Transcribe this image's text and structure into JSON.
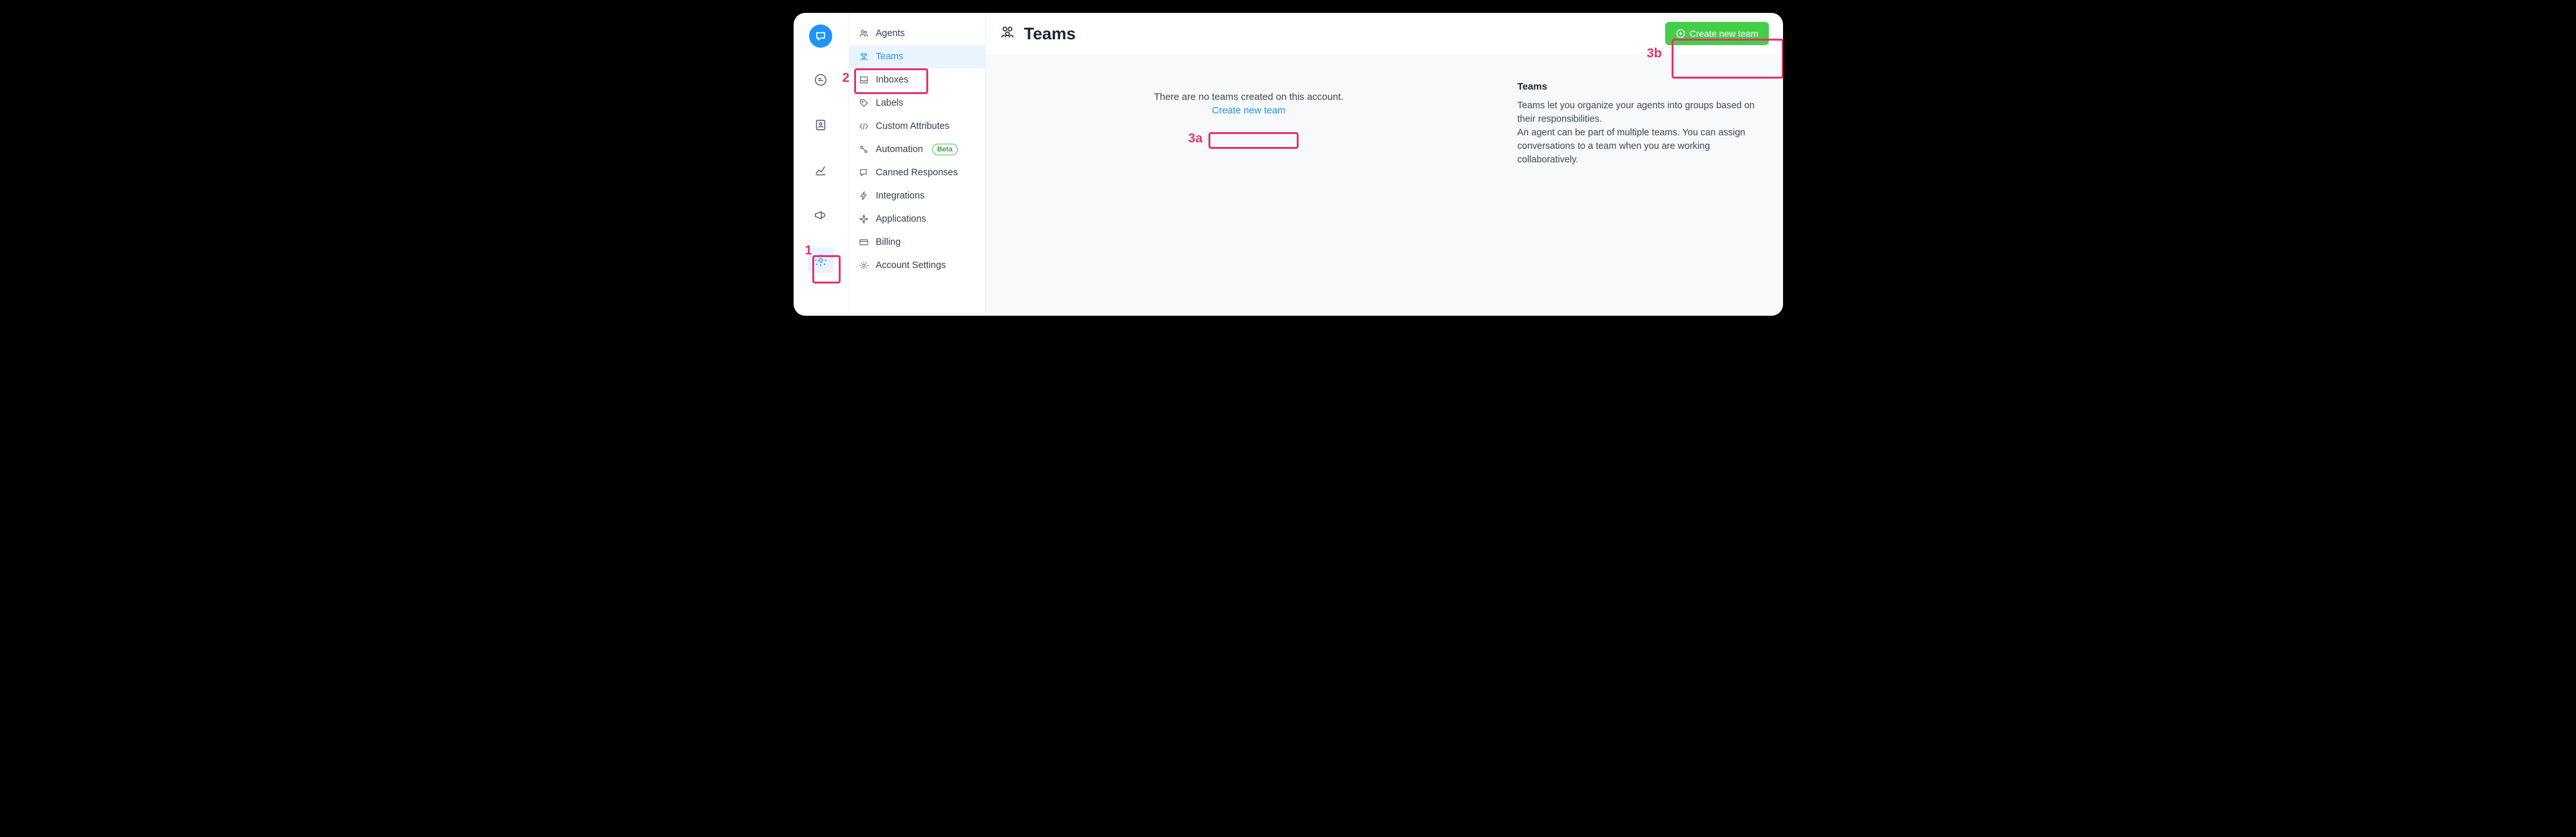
{
  "annotations": {
    "a1": "1",
    "a2": "2",
    "a3a": "3a",
    "a3b": "3b"
  },
  "sidebar": {
    "items": [
      {
        "label": "Agents"
      },
      {
        "label": "Teams"
      },
      {
        "label": "Inboxes"
      },
      {
        "label": "Labels"
      },
      {
        "label": "Custom Attributes"
      },
      {
        "label": "Automation",
        "badge": "Beta"
      },
      {
        "label": "Canned Responses"
      },
      {
        "label": "Integrations"
      },
      {
        "label": "Applications"
      },
      {
        "label": "Billing"
      },
      {
        "label": "Account Settings"
      }
    ]
  },
  "header": {
    "title": "Teams",
    "create_label": "Create new team"
  },
  "empty": {
    "text": "There are no teams created on this account.",
    "link": "Create new team"
  },
  "info": {
    "title": "Teams",
    "line1": "Teams let you organize your agents into groups based on their responsibilities.",
    "line2": "An agent can be part of multiple teams. You can assign conversations to a team when you are working collaboratively."
  }
}
